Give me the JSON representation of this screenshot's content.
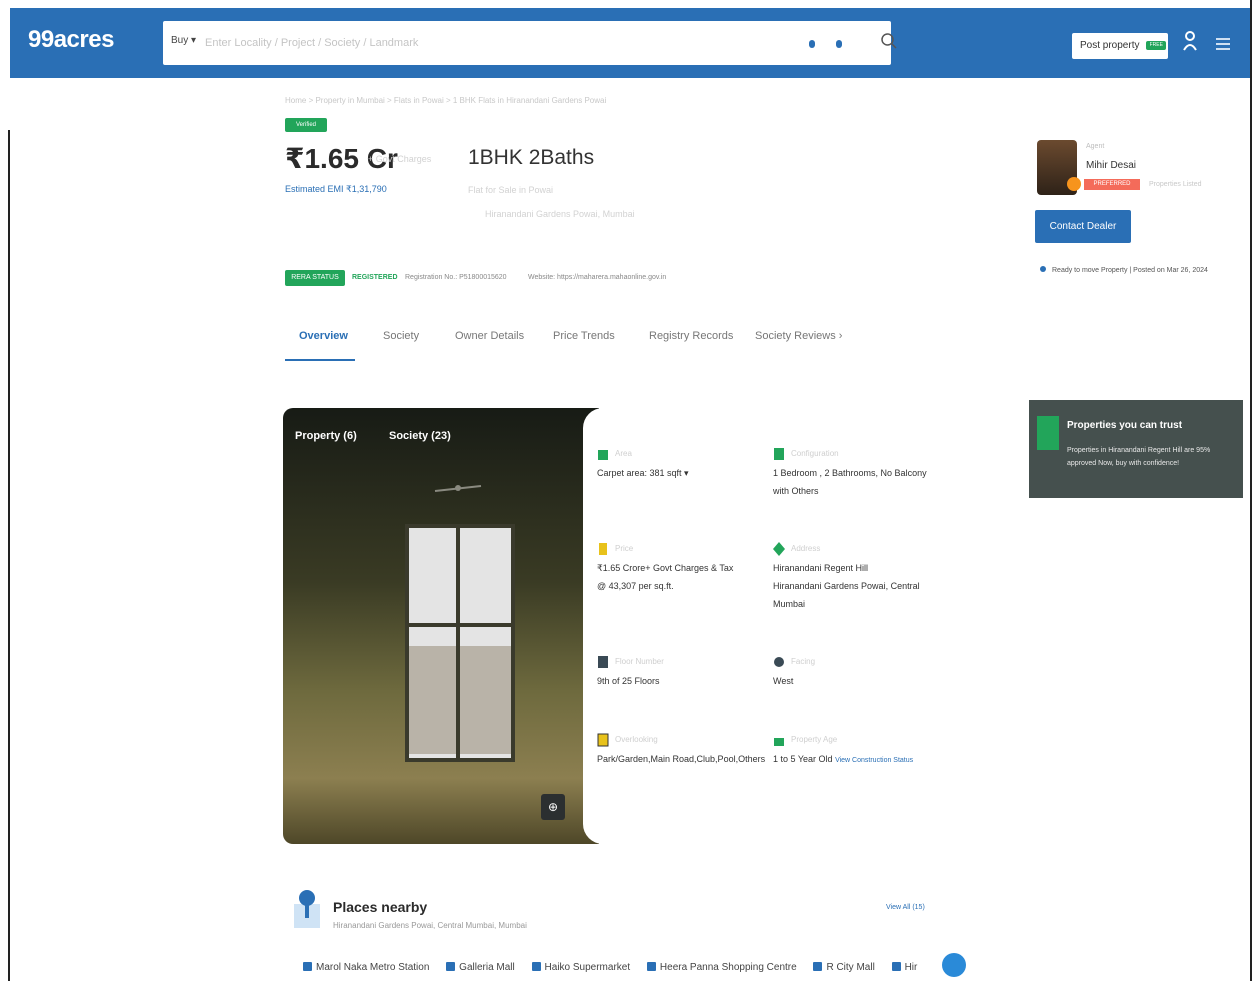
{
  "header": {
    "logo": "99acres",
    "search_mode": "Buy ▾",
    "search_placeholder": "Enter Locality / Project / Society / Landmark",
    "post_property": "Post property",
    "post_badge": "FREE"
  },
  "listing": {
    "breadcrumb": "Home > Property in Mumbai > Flats in Powai > 1 BHK Flats in Hiranandani Gardens Powai",
    "verified": "Verified",
    "price": "₹1.65 Cr",
    "price_note": "+ Govt Charges",
    "emi": "Estimated EMI ₹1,31,790",
    "config": "1BHK 2Baths",
    "config_line1": "Flat for Sale in Powai",
    "config_line2": "Hiranandani Gardens Powai, Mumbai"
  },
  "agent": {
    "kind": "Agent",
    "name": "Mihir Desai",
    "tag": "PREFERRED AGENT",
    "extra": "Properties Listed",
    "contact_label": "Contact Dealer",
    "ready_text": "Ready to move Property  |  Posted on Mar 26, 2024"
  },
  "rera": {
    "badge": "RERA STATUS",
    "registered": "REGISTERED",
    "registration": "Registration No.: P51800015620",
    "website": "Website: https://maharera.mahaonline.gov.in"
  },
  "tabs": [
    "Overview",
    "Society",
    "Owner Details",
    "Price Trends",
    "Registry Records",
    "Society Reviews  ›"
  ],
  "photo": {
    "property_tab": "Property (6)",
    "society_tab": "Society (23)"
  },
  "details": {
    "area_label": "Area",
    "area_value": "Carpet area: 381  sqft ▾",
    "config_label": "Configuration",
    "config_value_1": "1 Bedroom , 2 Bathrooms, No Balcony",
    "config_value_2": "with Others",
    "price_label": "Price",
    "price_value_1": "₹1.65 Crore+ Govt Charges & Tax",
    "price_value_2": "@ 43,307 per sq.ft.",
    "address_label": "Address",
    "address_value_1": "Hiranandani Regent Hill",
    "address_value_2": "Hiranandani Gardens Powai, Central",
    "address_value_3": "Mumbai",
    "floor_label": "Floor Number",
    "floor_value": "9th of 25 Floors",
    "facing_label": "Facing",
    "facing_value": "West",
    "overlooking_label": "Overlooking",
    "overlooking_value": "Park/Garden,Main Road,Club,Pool,Others",
    "age_label": "Property Age",
    "age_value": "1 to 5 Year Old",
    "age_link": "View Construction Status"
  },
  "trust": {
    "title": "Properties you can trust",
    "desc": "Properties in Hiranandani Regent Hill are 95% approved Now, buy with confidence!"
  },
  "places": {
    "title": "Places nearby",
    "subtitle": "Hiranandani Gardens Powai, Central Mumbai, Mumbai",
    "view_all": "View All (15)",
    "chips": [
      "Marol Naka Metro Station",
      "Galleria Mall",
      "Haiko Supermarket",
      "Heera Panna Shopping Centre",
      "R City Mall",
      "Hir"
    ]
  },
  "colors": {
    "brand_blue": "#2a6fb5",
    "green": "#22a55a",
    "trust_bg": "#45504e"
  }
}
